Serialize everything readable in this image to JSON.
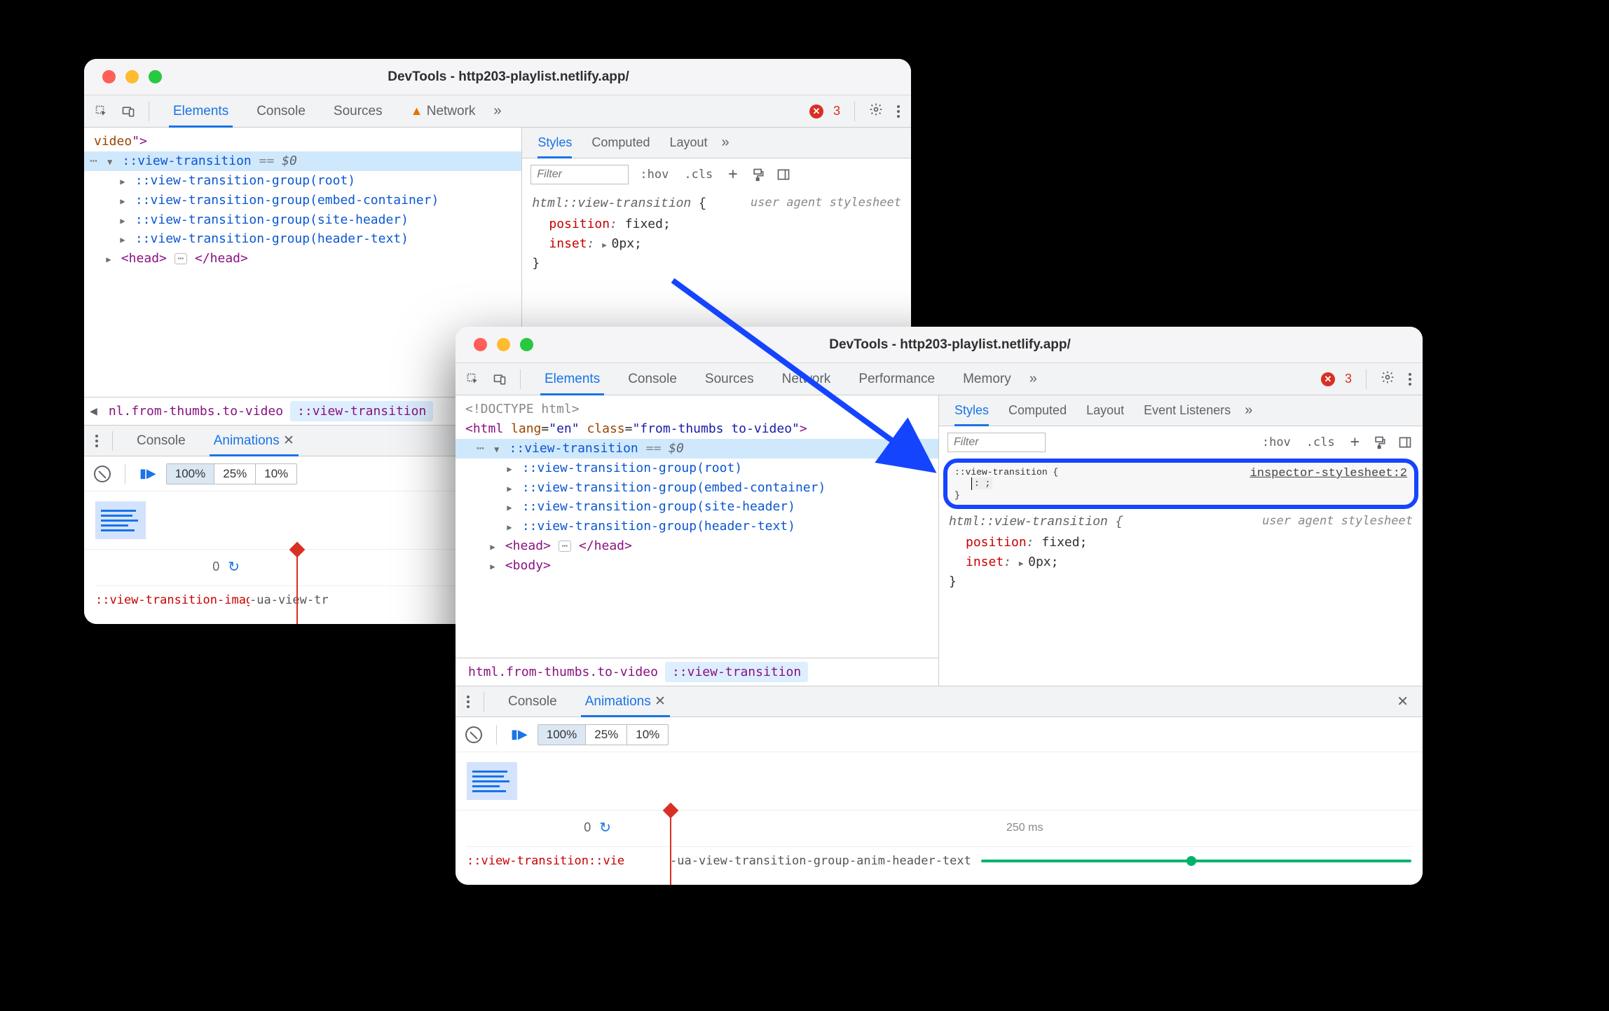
{
  "win1": {
    "title": "DevTools - http203-playlist.netlify.app/",
    "tabs": [
      "Elements",
      "Console",
      "Sources",
      "Network"
    ],
    "activeTab": "Elements",
    "networkWarn": true,
    "errorCount": "3",
    "dom": {
      "line1_prefix": "video",
      "line1_suffix": "\">",
      "selected": {
        "pseudo": "::view-transition",
        "eq": " == ",
        "dollar": "$0"
      },
      "groups": [
        "::view-transition-group(root)",
        "::view-transition-group(embed-container)",
        "::view-transition-group(site-header)",
        "::view-transition-group(header-text)"
      ],
      "headOpen": "<head>",
      "headEllipsis": "⋯",
      "headClose": "</head>"
    },
    "crumbs": {
      "left": "nl.from-thumbs.to-video",
      "right": "::view-transition"
    },
    "stylesTabs": [
      "Styles",
      "Computed",
      "Layout"
    ],
    "filterPlaceholder": "Filter",
    "miniBtns": {
      "hov": ":hov",
      "cls": ".cls",
      "plus": "+"
    },
    "css": {
      "selector": "html::view-transition",
      "source": "user agent stylesheet",
      "prop1": "position",
      "val1": "fixed",
      "prop2": "inset",
      "val2": "0px"
    },
    "drawer": {
      "tabs": [
        "Console",
        "Animations"
      ],
      "activeTab": "Animations",
      "pcts": [
        "100%",
        "25%",
        "10%"
      ],
      "zero": "0",
      "animName": "::view-transition-imag",
      "animDesc": "-ua-view-tr"
    }
  },
  "win2": {
    "title": "DevTools - http203-playlist.netlify.app/",
    "tabs": [
      "Elements",
      "Console",
      "Sources",
      "Network",
      "Performance",
      "Memory"
    ],
    "activeTab": "Elements",
    "errorCount": "3",
    "dom": {
      "doctype": "<!DOCTYPE html>",
      "htmlOpen1": "<html ",
      "htmlAttr1n": "lang",
      "htmlAttr1v": "\"en\"",
      "htmlAttr2n": "class",
      "htmlAttr2v": "\"from-thumbs to-video\"",
      "htmlClose": ">",
      "selected": {
        "pseudo": "::view-transition",
        "eq": " == ",
        "dollar": "$0"
      },
      "groups": [
        "::view-transition-group(root)",
        "::view-transition-group(embed-container)",
        "::view-transition-group(site-header)",
        "::view-transition-group(header-text)"
      ],
      "headOpen": "<head>",
      "headEllipsis": "⋯",
      "headClose": "</head>",
      "bodyOpen": "<body>"
    },
    "crumbs": {
      "left": "html.from-thumbs.to-video",
      "right": "::view-transition"
    },
    "stylesTabs": [
      "Styles",
      "Computed",
      "Layout",
      "Event Listeners"
    ],
    "filterPlaceholder": "Filter",
    "miniBtns": {
      "hov": ":hov",
      "cls": ".cls",
      "plus": "+"
    },
    "cssEdit": {
      "selector": "::view-transition {",
      "source": "inspector-stylesheet:2",
      "editLine": ": ;",
      "close": "}"
    },
    "css": {
      "selector": "html::view-transition {",
      "source": "user agent stylesheet",
      "prop1": "position",
      "val1": "fixed",
      "prop2": "inset",
      "val2": "0px",
      "close": "}"
    },
    "drawer": {
      "tabs": [
        "Console",
        "Animations"
      ],
      "activeTab": "Animations",
      "pcts": [
        "100%",
        "25%",
        "10%"
      ],
      "zero": "0",
      "t250": "250 ms",
      "animName": "::view-transition::vie",
      "animDesc": "-ua-view-transition-group-anim-header-text"
    }
  }
}
